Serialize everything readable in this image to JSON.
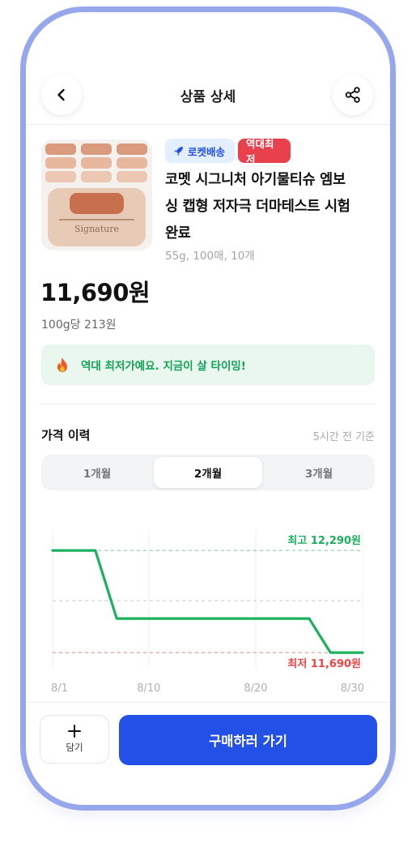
{
  "header": {
    "title": "상품 상세",
    "back_icon": "chevron-left-icon",
    "share_icon": "share-icon"
  },
  "product": {
    "image_alt": "Signature",
    "badges": {
      "rocket": "로켓배송",
      "lowest": "역대최저"
    },
    "name_line1": "코멧 시그니처 아기물티슈 엠보",
    "name_line2": "싱 캡형 저자극 더마테스트 시험",
    "name_line3": "완료",
    "spec": "55g, 100매, 10개",
    "price": "11,690원",
    "unit_price": "100g당 213원"
  },
  "notice": {
    "icon": "fire-icon",
    "text": "역대 최저가예요. 지금이 살 타이밍!"
  },
  "history": {
    "title": "가격 이력",
    "updated": "5시간 전 기준",
    "periods": [
      "1개월",
      "2개월",
      "3개월"
    ],
    "selected_period": "2개월"
  },
  "chart_data": {
    "type": "line",
    "x": [
      "8/1",
      "8/5",
      "8/7",
      "8/25",
      "8/27",
      "8/30"
    ],
    "series": [
      {
        "values": [
          12290,
          12290,
          11890,
          11890,
          11690,
          11690
        ]
      }
    ],
    "x_ticks": [
      "8/1",
      "8/10",
      "8/20",
      "8/30"
    ],
    "max_label": "최고 12,290원",
    "min_label": "최저 11,690원",
    "max": 12290,
    "min": 11690,
    "ylim": [
      11500,
      12500
    ],
    "colors": {
      "line": "#1db05c",
      "max": "#1db05c",
      "min": "#ef4444",
      "mid": "#cfcfcf"
    }
  },
  "footer": {
    "cart_label": "담기",
    "cart_icon": "plus-icon",
    "buy_label": "구매하러 가기"
  },
  "colors": {
    "accent": "#2350e6",
    "badge_red": "#e8414d",
    "badge_blue_bg": "#e3efff",
    "notice_bg": "#eaf7ef",
    "notice_text": "#13a355",
    "frame": "#97a7ec"
  }
}
